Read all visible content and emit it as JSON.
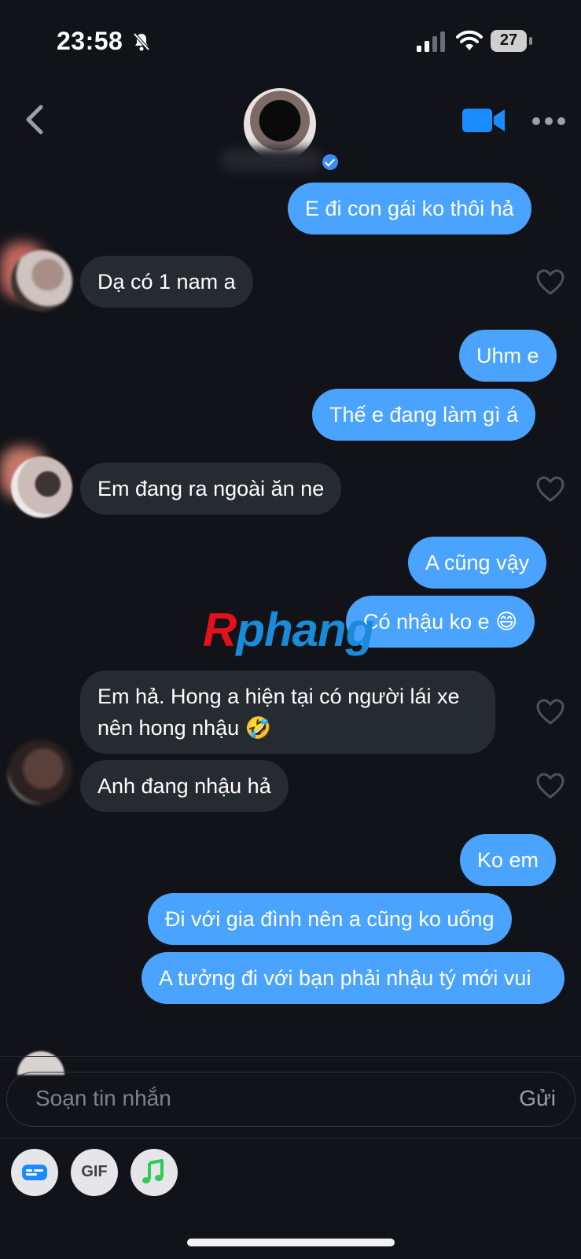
{
  "status_bar": {
    "time": "23:58",
    "battery": "27"
  },
  "header": {
    "icons": [
      "back-chevron-icon",
      "video-camera-icon",
      "more-dots-icon",
      "verified-badge-icon"
    ]
  },
  "messages": [
    {
      "id": "m1",
      "direction": "outgoing",
      "text": "E đi con gái ko thôi hả"
    },
    {
      "id": "m2",
      "direction": "incoming",
      "text": "Dạ có 1 nam a"
    },
    {
      "id": "m3",
      "direction": "outgoing",
      "text": "Uhm e"
    },
    {
      "id": "m4",
      "direction": "outgoing",
      "text": "Thế e đang làm gì á"
    },
    {
      "id": "m5",
      "direction": "incoming",
      "text": "Em đang ra ngoài ăn ne"
    },
    {
      "id": "m6",
      "direction": "outgoing",
      "text": "A cũng vậy"
    },
    {
      "id": "m7",
      "direction": "outgoing",
      "text": "Có nhậu ko e 😄"
    },
    {
      "id": "m8",
      "direction": "incoming",
      "text": "Em hả. Hong a hiện tại có người lái xe nên hong nhậu 🤣"
    },
    {
      "id": "m9",
      "direction": "incoming",
      "text": "Anh đang nhậu hả"
    },
    {
      "id": "m10",
      "direction": "outgoing",
      "text": "Ko em"
    },
    {
      "id": "m11",
      "direction": "outgoing",
      "text": "Đi với gia đình nên a cũng ko uống"
    },
    {
      "id": "m12",
      "direction": "outgoing",
      "text": "A tưởng đi với bạn phải nhậu tý mới vui"
    }
  ],
  "watermark": {
    "first": "R",
    "rest": "phang"
  },
  "composer": {
    "placeholder": "Soạn tin nhắn",
    "send_label": "Gửi",
    "gif_label": "GIF",
    "icons": [
      "contact-card-icon",
      "gif-icon",
      "music-note-icon"
    ]
  },
  "colors": {
    "background": "#111318",
    "outgoing_bubble": "#4aa3ff",
    "incoming_bubble": "#262a31",
    "accent": "#1a8cff",
    "music_green": "#2ecc55"
  }
}
